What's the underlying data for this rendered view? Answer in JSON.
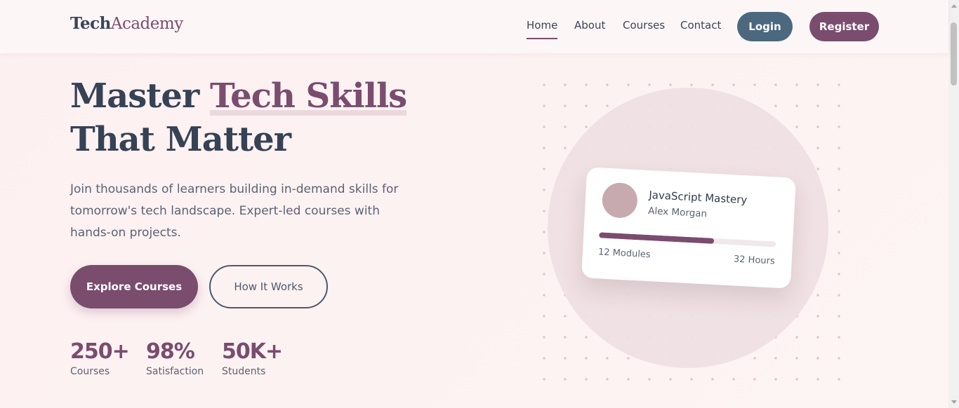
{
  "brand": {
    "logo_part1": "Tech",
    "logo_part2": "Academy",
    "accent_color": "#7a4c6e",
    "dark_color": "#364255",
    "login_color": "#4b687f"
  },
  "nav": {
    "links": [
      "Home",
      "About",
      "Courses",
      "Contact"
    ],
    "active": "Home",
    "login_label": "Login",
    "register_label": "Register"
  },
  "hero": {
    "title_part1": "Master ",
    "title_highlight": "Tech Skills",
    "title_part2": " That Matter",
    "subtitle": "Join thousands of learners building in-demand skills for tomorrow's tech landscape. Expert-led courses with hands-on projects.",
    "primary_button": "Explore Courses",
    "secondary_button": "How It Works"
  },
  "stats": [
    {
      "value": "250+",
      "label": "Courses"
    },
    {
      "value": "98%",
      "label": "Satisfaction"
    },
    {
      "value": "50K+",
      "label": "Students"
    }
  ],
  "course_card": {
    "title": "JavaScript Mastery",
    "author": "Alex Morgan",
    "progress_percent": 65,
    "modules": "12 Modules",
    "hours": "32 Hours"
  }
}
